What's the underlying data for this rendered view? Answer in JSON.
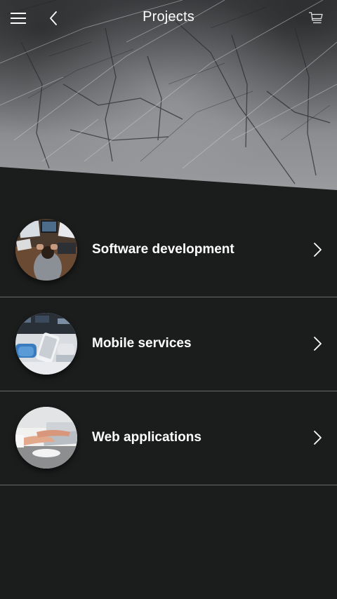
{
  "header": {
    "title": "Projects",
    "menu_icon": "hamburger-menu-icon",
    "back_icon": "chevron-left-icon",
    "cart_icon": "shopping-cart-icon"
  },
  "list": {
    "items": [
      {
        "label": "Software development",
        "image": "developer-desk-photo"
      },
      {
        "label": "Mobile services",
        "image": "phone-repair-photo"
      },
      {
        "label": "Web applications",
        "image": "laptop-typing-photo"
      }
    ]
  },
  "colors": {
    "background": "#1b1c1c",
    "divider": "#6a6b6c",
    "text": "#ffffff"
  }
}
